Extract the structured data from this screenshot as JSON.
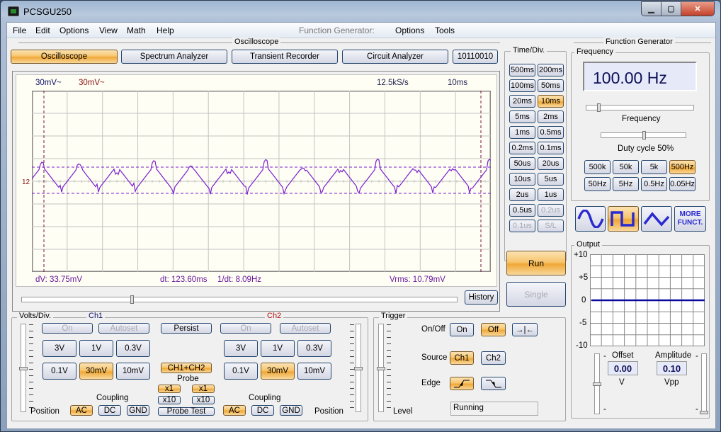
{
  "window": {
    "title": "PCSGU250",
    "controls": [
      "minimize",
      "maximize",
      "close"
    ]
  },
  "menu": {
    "left": [
      "File",
      "Edit",
      "Options",
      "View",
      "Math",
      "Help"
    ],
    "fg_label": "Function Generator:",
    "right": [
      "Options",
      "Tools"
    ]
  },
  "oscilloscope": {
    "group_title": "Oscilloscope",
    "tabs": [
      {
        "label": "Oscilloscope",
        "active": true
      },
      {
        "label": "Spectrum Analyzer"
      },
      {
        "label": "Transient Recorder"
      },
      {
        "label": "Circuit Analyzer"
      },
      {
        "label": "10110010"
      }
    ],
    "display": {
      "ch1_scale": "30mV~",
      "ch2_scale": "30mV~",
      "sample_rate": "12.5kS/s",
      "timebase": "10ms",
      "marker": "12",
      "dv": "dV: 33.75mV",
      "dt": "dt: 123.60ms",
      "inv_dt": "1/dt: 8.09Hz",
      "vrms": "Vrms: 10.79mV",
      "trace_color": "#7a1fd0"
    },
    "history_label": "History",
    "history_position": 0.25
  },
  "timediv": {
    "title": "Time/Div.",
    "buttons": [
      {
        "label": "500ms"
      },
      {
        "label": "200ms"
      },
      {
        "label": "100ms"
      },
      {
        "label": "50ms"
      },
      {
        "label": "20ms"
      },
      {
        "label": "10ms",
        "active": true
      },
      {
        "label": "5ms"
      },
      {
        "label": "2ms"
      },
      {
        "label": "1ms"
      },
      {
        "label": "0.5ms"
      },
      {
        "label": "0.2ms"
      },
      {
        "label": "0.1ms"
      },
      {
        "label": "50us"
      },
      {
        "label": "20us"
      },
      {
        "label": "10us"
      },
      {
        "label": "5us"
      },
      {
        "label": "2us"
      },
      {
        "label": "1us"
      },
      {
        "label": "0.5us"
      },
      {
        "label": "0.2us",
        "disabled": true
      },
      {
        "label": "0.1us",
        "disabled": true
      },
      {
        "label": "S/L",
        "disabled": true
      }
    ],
    "run": "Run",
    "single": "Single"
  },
  "voltsdiv": {
    "title": "Volts/Div.",
    "ch1": "Ch1",
    "ch2": "Ch2",
    "on": "On",
    "autoset": "Autoset",
    "persist": "Persist",
    "ch1ch2": "CH1+CH2",
    "volts": [
      "3V",
      "1V",
      "0.3V",
      "0.1V",
      "30mV",
      "10mV"
    ],
    "selected": "30mV",
    "probe": "Probe",
    "x1": "x1",
    "x10": "x10",
    "probe_test": "Probe Test",
    "coupling": "Coupling",
    "couplings": [
      "AC",
      "DC",
      "GND"
    ],
    "coupling_selected": "AC",
    "position": "Position"
  },
  "trigger": {
    "title": "Trigger",
    "onoff": "On/Off",
    "on": "On",
    "off": "Off",
    "center": "→|←",
    "source": "Source",
    "ch1": "Ch1",
    "ch2": "Ch2",
    "edge": "Edge",
    "level": "Level",
    "status": "Running"
  },
  "funcgen": {
    "title": "Function Generator",
    "freq_group": "Frequency",
    "freq_value": "100.00 Hz",
    "freq_slider_label": "Frequency",
    "duty_label": "Duty cycle 50%",
    "duty_percent": 50,
    "ranges": [
      "500k",
      "50k",
      "5k",
      "500Hz",
      "50Hz",
      "5Hz",
      "0.5Hz",
      "0.05Hz"
    ],
    "range_selected": "500Hz",
    "waveforms": [
      "sine",
      "square",
      "triangle"
    ],
    "waveform_selected": "square",
    "more": "MORE FUNCT.",
    "output_title": "Output",
    "y_labels": [
      "+10",
      "+5",
      "0",
      "-5",
      "-10"
    ],
    "offset_label": "Offset",
    "offset_value": "0.00",
    "offset_unit": "V",
    "amp_label": "Amplitude",
    "amp_value": "0.10",
    "amp_unit": "Vpp"
  }
}
